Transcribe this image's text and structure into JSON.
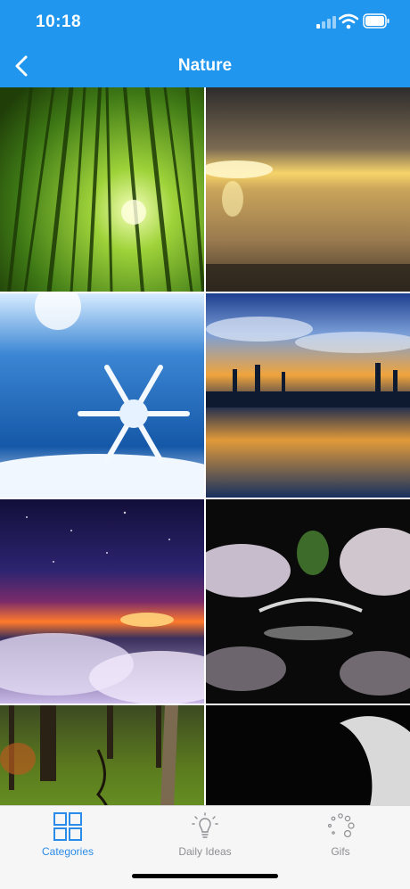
{
  "status_bar": {
    "time": "10:18",
    "icons": [
      "signal-icon",
      "wifi-icon",
      "battery-icon"
    ]
  },
  "nav": {
    "title": "Nature",
    "back_icon": "chevron-left-icon"
  },
  "grid": {
    "images": [
      {
        "name": "bamboo-forest",
        "colors": [
          "#2f5a12",
          "#9fd33a"
        ]
      },
      {
        "name": "beach-sunset",
        "colors": [
          "#3a3836",
          "#f7d46a"
        ]
      },
      {
        "name": "snowflake",
        "colors": [
          "#1a5fb4",
          "#e9f3ff"
        ]
      },
      {
        "name": "lake-reflection",
        "colors": [
          "#1e3f8f",
          "#f0a43c"
        ]
      },
      {
        "name": "galaxy-sunset-clouds",
        "colors": [
          "#1b1a4d",
          "#ff7a2b"
        ]
      },
      {
        "name": "cherry-blossom-bridge",
        "colors": [
          "#0d0d0d",
          "#f1e6f0"
        ]
      },
      {
        "name": "mossy-forest",
        "colors": [
          "#4a6a18",
          "#7ec32d"
        ]
      },
      {
        "name": "crescent-moon",
        "colors": [
          "#050505",
          "#d9d9d9"
        ]
      }
    ]
  },
  "tabbar": {
    "tabs": [
      {
        "label": "Categories",
        "icon": "grid-icon",
        "active": true
      },
      {
        "label": "Daily Ideas",
        "icon": "lightbulb-icon",
        "active": false
      },
      {
        "label": "Gifs",
        "icon": "loading-dots-icon",
        "active": false
      }
    ],
    "active_color": "#2a8be8",
    "inactive_color": "#8e8e93"
  },
  "colors": {
    "header": "#2196ee",
    "tabbar_bg": "#f6f6f6"
  }
}
